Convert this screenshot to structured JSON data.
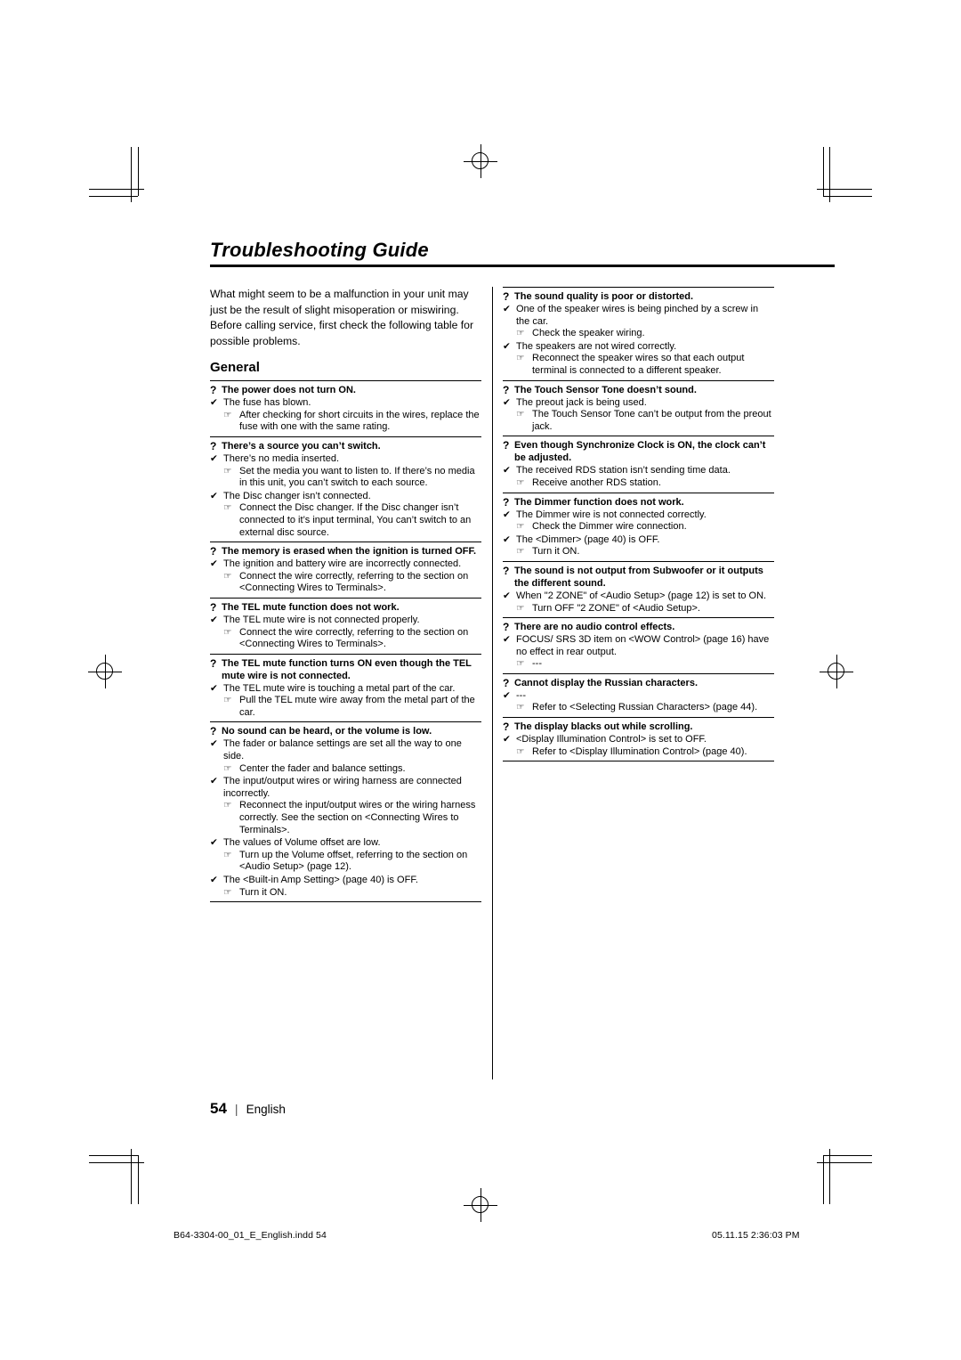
{
  "document": {
    "title": "Troubleshooting Guide",
    "intro": "What might seem to be a malfunction in your unit may just be the result of slight misoperation or miswiring. Before calling service, first check the following table for possible problems.",
    "section_heading": "General",
    "page_number": "54",
    "language": "English"
  },
  "print_marks": {
    "left": "B64-3304-00_01_E_English.indd   54",
    "right": "05.11.15   2:36:03 PM"
  },
  "icons": {
    "question": "?",
    "check": "✔",
    "hand": "☞"
  },
  "left_column": [
    {
      "question": "The power does not turn ON.",
      "items": [
        {
          "type": "cause",
          "text": "The fuse has blown."
        },
        {
          "type": "remedy",
          "text": "After checking for short circuits in the wires, replace the fuse with one with the same rating."
        }
      ]
    },
    {
      "question": "There’s a source you can’t switch.",
      "items": [
        {
          "type": "cause",
          "text": "There’s no media inserted."
        },
        {
          "type": "remedy",
          "text": "Set the media you want to listen to. If there’s no media in this unit, you can’t switch to each source."
        },
        {
          "type": "cause",
          "text": "The Disc changer isn’t connected."
        },
        {
          "type": "remedy",
          "text": "Connect the Disc changer. If the Disc changer isn’t connected to it’s input terminal, You can’t switch to an external disc source."
        }
      ]
    },
    {
      "question": "The memory is erased when the ignition is turned OFF.",
      "items": [
        {
          "type": "cause",
          "text": "The ignition and battery wire are incorrectly connected."
        },
        {
          "type": "remedy",
          "text": "Connect the wire correctly, referring to the section on <Connecting Wires to Terminals>."
        }
      ]
    },
    {
      "question": "The TEL mute function does not work.",
      "items": [
        {
          "type": "cause",
          "text": "The TEL mute wire is not connected properly."
        },
        {
          "type": "remedy",
          "text": "Connect the wire correctly, referring to the section on <Connecting Wires to Terminals>."
        }
      ]
    },
    {
      "question": "The TEL mute function turns ON even though the TEL mute wire is not connected.",
      "items": [
        {
          "type": "cause",
          "text": "The TEL mute wire is touching a metal part of the car."
        },
        {
          "type": "remedy",
          "text": "Pull the TEL mute wire away from the metal part of the car."
        }
      ]
    },
    {
      "question": "No sound can be heard, or the volume is low.",
      "items": [
        {
          "type": "cause",
          "text": "The fader or balance settings are set all the way to one side."
        },
        {
          "type": "remedy",
          "text": "Center the fader and balance settings."
        },
        {
          "type": "cause",
          "text": "The input/output wires or wiring harness are connected incorrectly."
        },
        {
          "type": "remedy",
          "text": "Reconnect the input/output wires or the wiring harness correctly. See the section on <Connecting Wires to Terminals>."
        },
        {
          "type": "cause",
          "text": "The values of Volume offset are low."
        },
        {
          "type": "remedy",
          "text": "Turn up the Volume offset, referring to the section on <Audio Setup> (page 12)."
        },
        {
          "type": "cause",
          "text": "The <Built-in Amp Setting> (page 40) is OFF."
        },
        {
          "type": "remedy",
          "text": "Turn it ON."
        }
      ]
    }
  ],
  "right_column": [
    {
      "question": "The sound quality is poor or distorted.",
      "items": [
        {
          "type": "cause",
          "text": "One of the speaker wires is being pinched by a screw in the car."
        },
        {
          "type": "remedy",
          "text": "Check the speaker wiring."
        },
        {
          "type": "cause",
          "text": "The speakers are not wired correctly."
        },
        {
          "type": "remedy",
          "text": "Reconnect the speaker wires so that each output terminal is connected to a different speaker."
        }
      ]
    },
    {
      "question": "The Touch Sensor Tone doesn’t sound.",
      "items": [
        {
          "type": "cause",
          "text": "The preout jack is being used."
        },
        {
          "type": "remedy",
          "text": "The Touch Sensor Tone can’t be output from the preout jack."
        }
      ]
    },
    {
      "question": "Even though Synchronize Clock is ON, the clock can’t be adjusted.",
      "items": [
        {
          "type": "cause",
          "text": "The received RDS station isn’t sending time data."
        },
        {
          "type": "remedy",
          "text": "Receive another RDS station."
        }
      ]
    },
    {
      "question": "The Dimmer function does not work.",
      "items": [
        {
          "type": "cause",
          "text": "The Dimmer wire is not connected correctly."
        },
        {
          "type": "remedy",
          "text": "Check the Dimmer wire connection."
        },
        {
          "type": "cause",
          "text": "The <Dimmer> (page 40) is OFF."
        },
        {
          "type": "remedy",
          "text": "Turn it ON."
        }
      ]
    },
    {
      "question": "The sound is not output from Subwoofer or it outputs the different sound.",
      "items": [
        {
          "type": "cause",
          "text": "When \"2 ZONE\" of <Audio Setup> (page 12) is set to ON."
        },
        {
          "type": "remedy",
          "text": "Turn OFF \"2 ZONE\" of <Audio Setup>."
        }
      ]
    },
    {
      "question": "There are no audio control effects.",
      "items": [
        {
          "type": "cause",
          "text": "FOCUS/ SRS 3D item on <WOW Control> (page 16) have no effect in rear output."
        },
        {
          "type": "remedy",
          "text": "---"
        }
      ]
    },
    {
      "question": "Cannot display the Russian characters.",
      "items": [
        {
          "type": "cause",
          "text": "---"
        },
        {
          "type": "remedy",
          "text": "Refer to <Selecting Russian Characters> (page 44)."
        }
      ]
    },
    {
      "question": "The display blacks out while scrolling.",
      "items": [
        {
          "type": "cause",
          "text": "<Display Illumination Control> is set to OFF."
        },
        {
          "type": "remedy",
          "text": "Refer to <Display Illumination Control> (page 40)."
        }
      ]
    }
  ]
}
